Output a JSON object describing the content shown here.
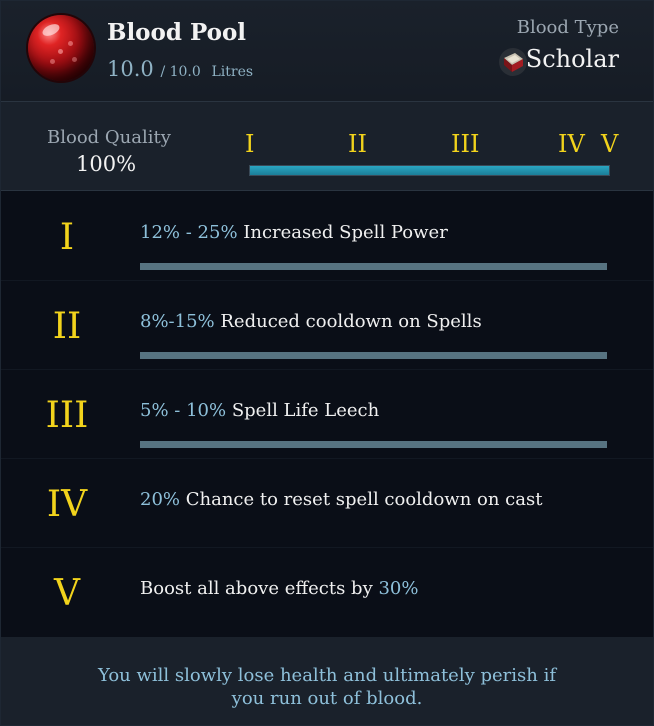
{
  "header": {
    "title": "Blood Pool",
    "current": "10.0",
    "max": "/ 10.0",
    "unit": "Litres",
    "orb_icon": "blood-orb-icon",
    "type_label": "Blood Type",
    "type_value": "Scholar",
    "type_icon": "book-icon"
  },
  "quality": {
    "label": "Blood Quality",
    "value": "100%",
    "fill_fraction": 1.0,
    "markers": [
      "I",
      "II",
      "III",
      "IV",
      "V"
    ],
    "bar_color": "#2aa6c2"
  },
  "tiers": [
    {
      "numeral": "I",
      "highlight": "12% - 25%",
      "text": " Increased Spell Power",
      "has_bar": true
    },
    {
      "numeral": "II",
      "highlight": "8%-15%",
      "text": " Reduced cooldown on Spells",
      "has_bar": true
    },
    {
      "numeral": "III",
      "highlight": "5% - 10%",
      "text": " Spell Life Leech",
      "has_bar": true
    },
    {
      "numeral": "IV",
      "highlight": "20%",
      "text": " Chance to reset spell cooldown on cast",
      "has_bar": false
    },
    {
      "numeral": "V",
      "prefix": "Boost all above effects by ",
      "highlight": "30%",
      "has_bar": false
    }
  ],
  "footer": {
    "warning_line1": "You will slowly lose health and ultimately perish if",
    "warning_line2": "you run out of blood."
  },
  "colors": {
    "numeral": "#f2d31c",
    "highlight": "#8ec0da",
    "tier_bar": "#577381"
  }
}
